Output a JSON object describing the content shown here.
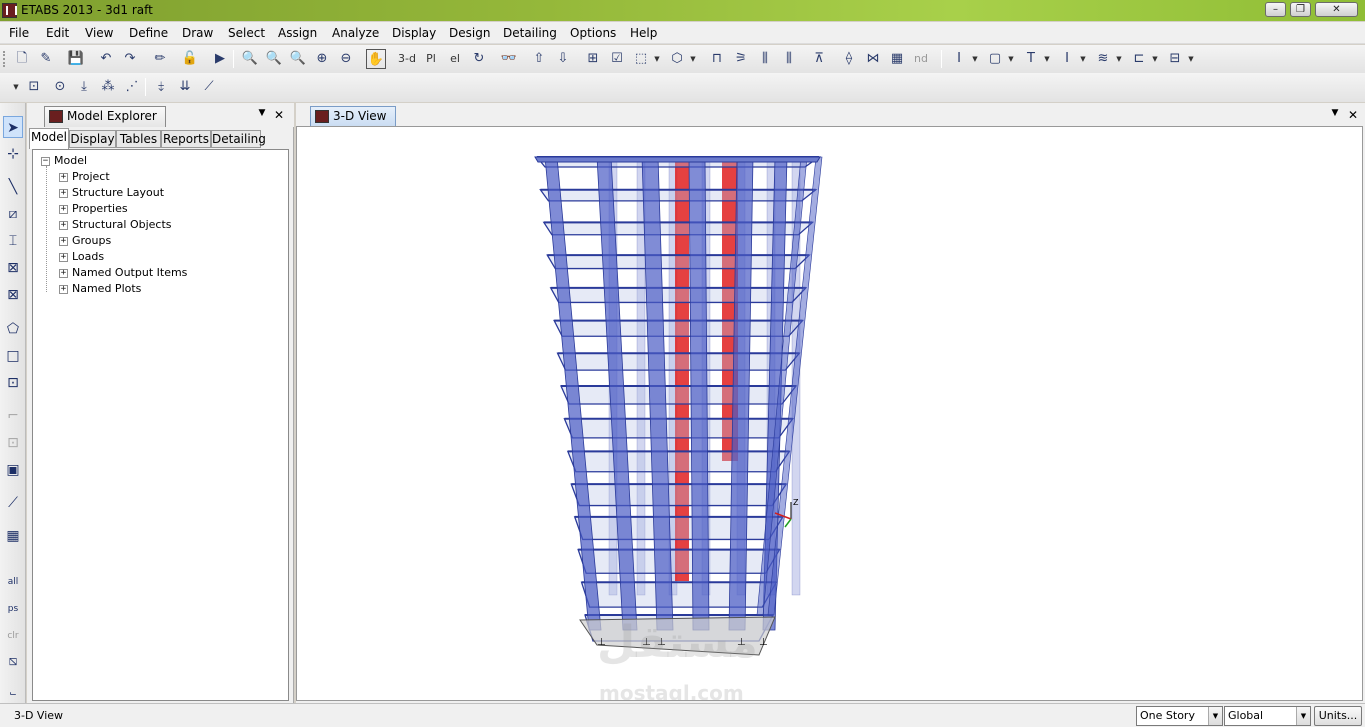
{
  "window": {
    "title": "ETABS 2013  -  3d1 raft",
    "buttons": [
      "–",
      "❐",
      "✕"
    ]
  },
  "menu": [
    "File",
    "Edit",
    "View",
    "Define",
    "Draw",
    "Select",
    "Assign",
    "Analyze",
    "Display",
    "Design",
    "Detailing",
    "Options",
    "Help"
  ],
  "toolbar": {
    "view_3d": "3-d",
    "plan": "Pl",
    "elevation": "el",
    "nd": "nd"
  },
  "left_toolbar": {
    "all": "all",
    "ps": "ps",
    "clr": "clr"
  },
  "explorer": {
    "title": "Model Explorer",
    "tabs": [
      "Model",
      "Display",
      "Tables",
      "Reports",
      "Detailing"
    ],
    "active_tab": "Model",
    "root": "Model",
    "items": [
      "Project",
      "Structure Layout",
      "Properties",
      "Structural Objects",
      "Groups",
      "Loads",
      "Named Output Items",
      "Named Plots"
    ]
  },
  "view": {
    "title": "3-D View",
    "axis_z": "Z",
    "watermark_top": "مستقل",
    "watermark_bottom": "mostaql.com"
  },
  "status": {
    "text": "3-D View",
    "story_combo": "One Story",
    "coord_combo": "Global",
    "units_button": "Units..."
  },
  "colors": {
    "title_bar": "#95b83a",
    "column": "#4a5bc4",
    "core_wall": "#e02020",
    "slab_edge": "#2a3a9a"
  }
}
